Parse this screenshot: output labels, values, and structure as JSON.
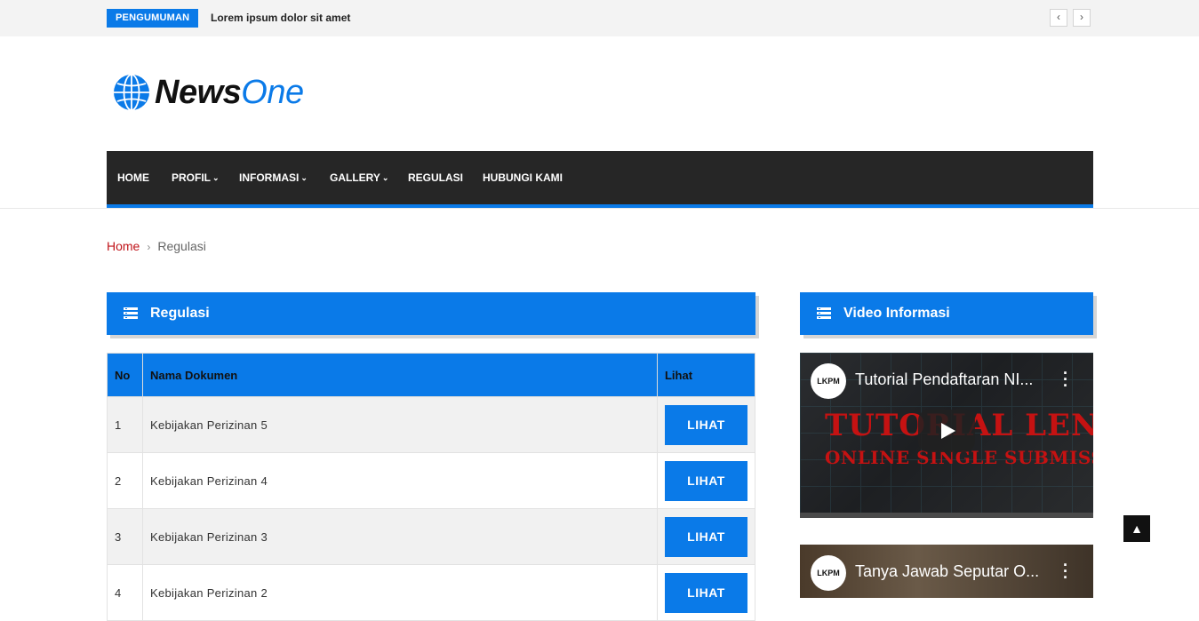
{
  "topbar": {
    "badge": "PENGUMUMAN",
    "ticker_text": "Lorem ipsum dolor sit amet",
    "prev": "‹",
    "next": "›"
  },
  "logo": {
    "part1": "News",
    "part2": "One"
  },
  "nav": {
    "items": [
      {
        "label": "HOME",
        "dropdown": false
      },
      {
        "label": "PROFIL",
        "dropdown": true
      },
      {
        "label": "INFORMASI",
        "dropdown": true
      },
      {
        "label": "GALLERY",
        "dropdown": true
      },
      {
        "label": "REGULASI",
        "dropdown": false
      },
      {
        "label": "HUBUNGI KAMI",
        "dropdown": false
      }
    ],
    "chevron": "❯"
  },
  "breadcrumb": {
    "home": "Home",
    "separator": "›",
    "current": "Regulasi"
  },
  "main": {
    "title": "Regulasi",
    "table": {
      "headers": [
        "No",
        "Nama Dokumen",
        "Lihat"
      ],
      "rows": [
        {
          "no": "1",
          "name": "Kebijakan Perizinan 5",
          "action": "LIHAT"
        },
        {
          "no": "2",
          "name": "Kebijakan Perizinan 4",
          "action": "LIHAT"
        },
        {
          "no": "3",
          "name": "Kebijakan Perizinan 3",
          "action": "LIHAT"
        },
        {
          "no": "4",
          "name": "Kebijakan Perizinan 2",
          "action": "LIHAT"
        }
      ]
    }
  },
  "sidebar": {
    "title": "Video Informasi",
    "videos": [
      {
        "channel": "LKPM",
        "title": "Tutorial Pendaftaran NI...",
        "overlay_line1": "TUTORIAL LENGKAP",
        "overlay_line2": "ONLINE SINGLE SUBMISSION"
      },
      {
        "channel": "LKPM",
        "title": "Tanya Jawab Seputar O..."
      }
    ]
  },
  "scroll_top": "▲",
  "colors": {
    "accent": "#0a7ae8",
    "nav_bg": "#262626",
    "link_red": "#c0141a"
  },
  "icons": {
    "panel": "list-icon",
    "logo": "globe-icon",
    "play": "play-icon",
    "menu": "more-vert-icon"
  }
}
